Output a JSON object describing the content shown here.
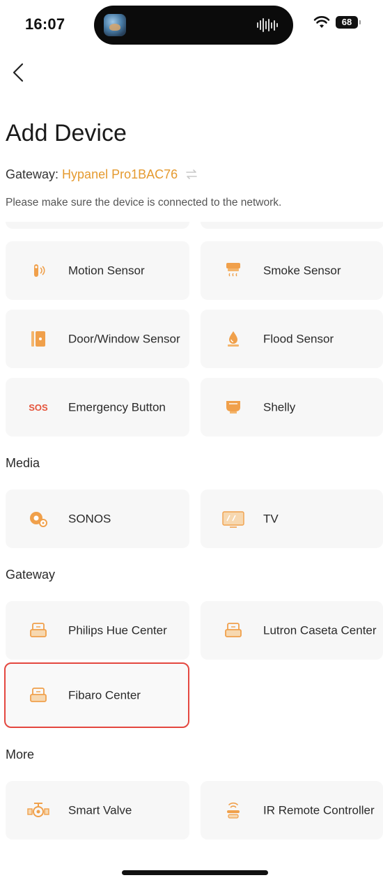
{
  "status_bar": {
    "time": "16:07",
    "battery": "68"
  },
  "header": {
    "title": "Add Device",
    "gateway_label": "Gateway: ",
    "gateway_name": "Hypanel Pro1BAC76",
    "hint": "Please make sure the device is connected to the network."
  },
  "sensors": [
    {
      "label": "Motion Sensor",
      "icon": "motion-sensor-icon"
    },
    {
      "label": "Smoke Sensor",
      "icon": "smoke-sensor-icon"
    },
    {
      "label": "Door/Window Sensor",
      "icon": "door-window-sensor-icon"
    },
    {
      "label": "Flood Sensor",
      "icon": "flood-sensor-icon"
    },
    {
      "label": "Emergency Button",
      "icon": "sos-icon",
      "icon_text": "SOS"
    },
    {
      "label": "Shelly",
      "icon": "shelly-icon"
    }
  ],
  "media": {
    "title": "Media",
    "items": [
      {
        "label": "SONOS",
        "icon": "sonos-speaker-icon"
      },
      {
        "label": "TV",
        "icon": "tv-icon"
      }
    ]
  },
  "gateway_section": {
    "title": "Gateway",
    "items": [
      {
        "label": "Philips Hue Center",
        "icon": "hub-icon"
      },
      {
        "label": "Lutron Caseta Center",
        "icon": "hub-icon"
      },
      {
        "label": "Fibaro Center",
        "icon": "hub-icon",
        "selected": true
      }
    ]
  },
  "more": {
    "title": "More",
    "items": [
      {
        "label": "Smart Valve",
        "icon": "valve-icon"
      },
      {
        "label": "IR Remote Controller",
        "icon": "ir-remote-icon"
      }
    ]
  },
  "colors": {
    "accent": "#e59a2f",
    "icon_orange": "#f0a04b",
    "selection": "#e4473f",
    "card_bg": "#f7f7f7"
  }
}
